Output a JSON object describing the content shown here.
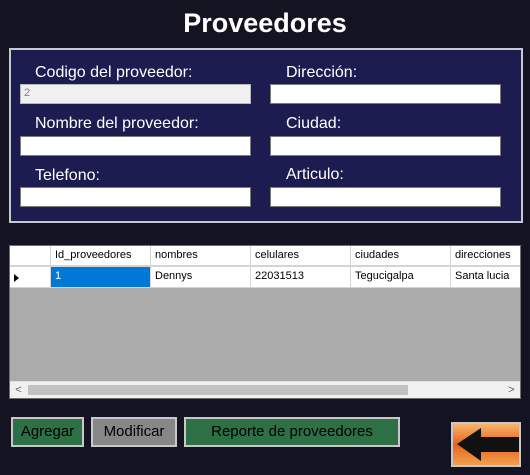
{
  "page": {
    "title": "Proveedores"
  },
  "form": {
    "codigo_label": "Codigo del proveedor:",
    "codigo_value": "2",
    "direccion_label": "Dirección:",
    "direccion_value": "",
    "nombre_label": "Nombre del proveedor:",
    "nombre_value": "",
    "ciudad_label": "Ciudad:",
    "ciudad_value": "",
    "telefono_label": "Telefono:",
    "telefono_value": "",
    "articulo_label": "Articulo:",
    "articulo_value": ""
  },
  "grid": {
    "columns": [
      "Id_proveedores",
      "nombres",
      "celulares",
      "ciudades",
      "direcciones"
    ],
    "rows": [
      [
        "1",
        "Dennys",
        "22031513",
        "Tegucigalpa",
        "Santa lucia"
      ]
    ],
    "scroll_left": "<",
    "scroll_right": ">"
  },
  "buttons": {
    "agregar": "Agregar",
    "modificar": "Modificar",
    "reporte": "Reporte de proveedores",
    "back_icon": "back-arrow-icon"
  },
  "colors": {
    "background": "#131321",
    "form_panel": "#1c1c50",
    "button_green": "#2e7046",
    "button_gray": "#878787",
    "selection": "#0078d7",
    "back_button": "#f4a356"
  }
}
